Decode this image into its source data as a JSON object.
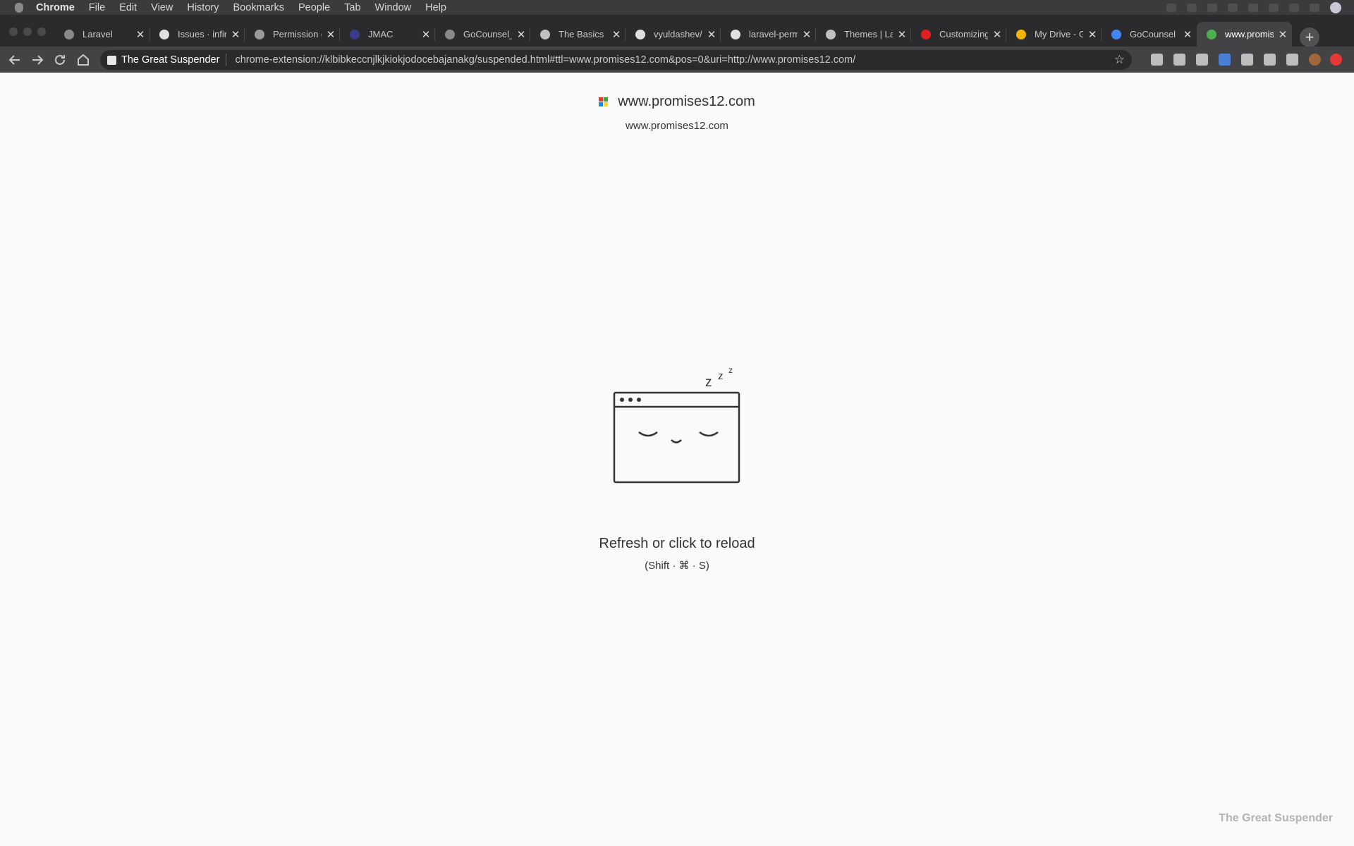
{
  "menubar": {
    "app_name": "Chrome",
    "items": [
      "File",
      "Edit",
      "View",
      "History",
      "Bookmarks",
      "People",
      "Tab",
      "Window",
      "Help"
    ]
  },
  "tabs": [
    {
      "title": "Laravel",
      "icon": "globe-icon",
      "color": "#8a8a8a"
    },
    {
      "title": "Issues · infir",
      "icon": "github-icon",
      "color": "#e0e0e0"
    },
    {
      "title": "Permission c",
      "icon": "apple-icon",
      "color": "#9a9a9a"
    },
    {
      "title": "JMAC",
      "icon": "jmac-icon",
      "color": "#3b3b8a"
    },
    {
      "title": "GoCounsel_",
      "icon": "globe-icon",
      "color": "#8a8a8a"
    },
    {
      "title": "The Basics |",
      "icon": "spiral-icon",
      "color": "#c0c0c0"
    },
    {
      "title": "vyuldashev/",
      "icon": "github-icon",
      "color": "#e0e0e0"
    },
    {
      "title": "laravel-perm",
      "icon": "github-icon",
      "color": "#e0e0e0"
    },
    {
      "title": "Themes | La",
      "icon": "spiral-icon",
      "color": "#c0c0c0"
    },
    {
      "title": "Customizing",
      "icon": "youtube-icon",
      "color": "#e02020"
    },
    {
      "title": "My Drive - G",
      "icon": "drive-icon",
      "color": "#f4b400"
    },
    {
      "title": "GoCounsel I",
      "icon": "docs-icon",
      "color": "#4285f4"
    },
    {
      "title": "www.promis",
      "icon": "suspended-favicon-icon",
      "color": "#4caf50"
    }
  ],
  "active_tab": 12,
  "omnibox": {
    "site_label": "The Great Suspender",
    "url": "chrome-extension://klbibkeccnjlkjkiokjodocebajanakg/suspended.html#ttl=www.promises12.com&pos=0&uri=http://www.promises12.com/"
  },
  "page": {
    "site_title": "www.promises12.com",
    "site_url": "www.promises12.com",
    "zzz": "z z z",
    "reload_text": "Refresh or click to reload",
    "shortcut_text": "(Shift · ⌘ · S)",
    "brand": "The Great Suspender"
  },
  "colors": {
    "page_bg": "#fafafa",
    "favicon": [
      "#e53935",
      "#43a047",
      "#1e88e5",
      "#fdd835"
    ]
  }
}
